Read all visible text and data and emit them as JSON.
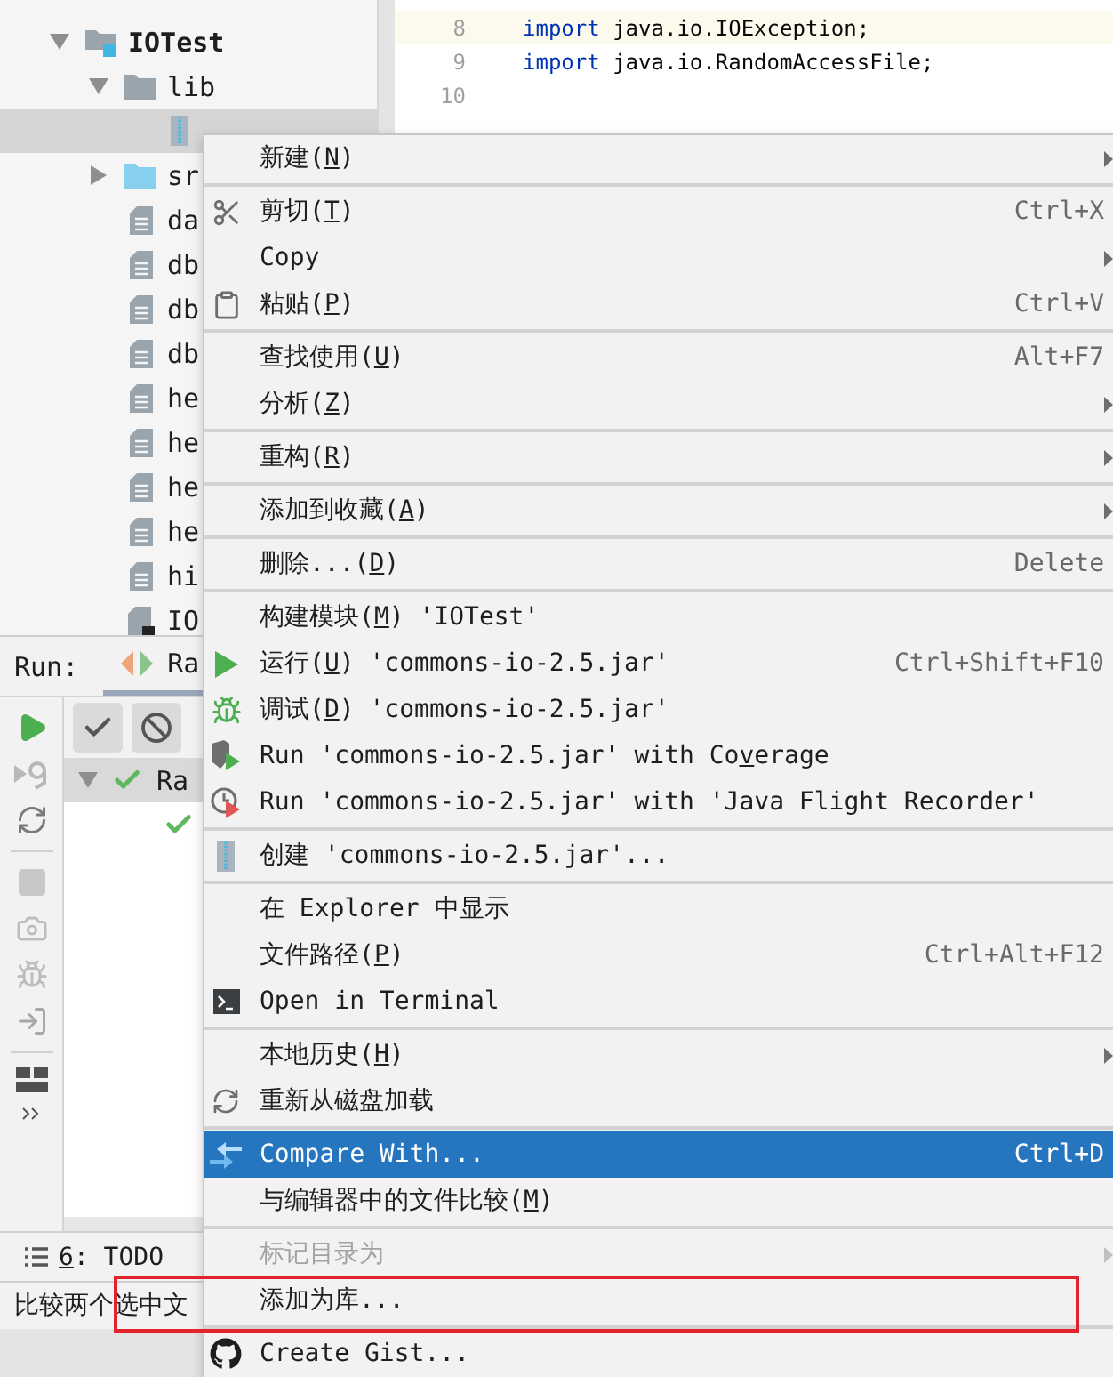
{
  "project_tree": [
    {
      "name": "IOTest",
      "kind": "module",
      "expanded": true,
      "selected": false,
      "children": [
        {
          "name": "lib",
          "kind": "folder",
          "expanded": true,
          "selected": false,
          "children": [
            {
              "kind": "jar",
              "selected": true
            }
          ]
        },
        {
          "name": "sr",
          "kind": "source",
          "expanded": false,
          "selected": false
        },
        {
          "name": "da",
          "kind": "file",
          "selected": false
        },
        {
          "name": "db",
          "kind": "file",
          "selected": false
        },
        {
          "name": "db",
          "kind": "file",
          "selected": false
        },
        {
          "name": "db",
          "kind": "file",
          "selected": false
        },
        {
          "name": "he",
          "kind": "file",
          "selected": false
        },
        {
          "name": "he",
          "kind": "file",
          "selected": false
        },
        {
          "name": "he",
          "kind": "file",
          "selected": false
        },
        {
          "name": "he",
          "kind": "file",
          "selected": false
        },
        {
          "name": "hi",
          "kind": "file",
          "selected": false
        },
        {
          "name": "IO",
          "kind": "config",
          "selected": false
        }
      ]
    }
  ],
  "editor": {
    "lines": [
      {
        "number": "8",
        "current": true,
        "tokens": [
          {
            "kind": "keyword",
            "text": "import"
          },
          {
            "kind": "plain",
            "text": " java.io.IOException;"
          }
        ]
      },
      {
        "number": "9",
        "current": false,
        "tokens": [
          {
            "kind": "keyword",
            "text": "import"
          },
          {
            "kind": "plain",
            "text": " java.io.RandomAccessFile;"
          }
        ]
      },
      {
        "number": "10",
        "current": false
      }
    ]
  },
  "run_panel": {
    "title": "Run:",
    "tabs": [
      {
        "label": "Ra",
        "selected": true
      }
    ],
    "results": [
      {
        "label": "Ra",
        "kind": "passed",
        "expanded": true,
        "selected": true
      },
      {
        "kind": "passed",
        "selected": false
      }
    ]
  },
  "todo_tab": {
    "label": [
      "6",
      ": TODO"
    ]
  },
  "status_bar": {
    "text": "比较两个选中文"
  },
  "context_menu": [
    {
      "kind": "item",
      "label": [
        "新建(",
        "N",
        ")"
      ],
      "submenu": true,
      "selected": false,
      "disabled": false
    },
    {
      "kind": "separator"
    },
    {
      "kind": "item",
      "label": [
        "剪切(",
        "T",
        ")"
      ],
      "shortcut": "Ctrl+X",
      "submenu": false,
      "selected": false,
      "disabled": false
    },
    {
      "kind": "item",
      "label": [
        "Copy"
      ],
      "submenu": true,
      "selected": false,
      "disabled": false
    },
    {
      "kind": "item",
      "label": [
        "粘贴(",
        "P",
        ")"
      ],
      "shortcut": "Ctrl+V",
      "submenu": false,
      "selected": false,
      "disabled": false
    },
    {
      "kind": "separator"
    },
    {
      "kind": "item",
      "label": [
        "查找使用(",
        "U",
        ")"
      ],
      "shortcut": "Alt+F7",
      "submenu": false,
      "selected": false,
      "disabled": false
    },
    {
      "kind": "item",
      "label": [
        "分析(",
        "Z",
        ")"
      ],
      "submenu": true,
      "selected": false,
      "disabled": false
    },
    {
      "kind": "separator"
    },
    {
      "kind": "item",
      "label": [
        "重构(",
        "R",
        ")"
      ],
      "submenu": true,
      "selected": false,
      "disabled": false
    },
    {
      "kind": "separator"
    },
    {
      "kind": "item",
      "label": [
        "添加到收藏(",
        "A",
        ")"
      ],
      "submenu": true,
      "selected": false,
      "disabled": false
    },
    {
      "kind": "separator"
    },
    {
      "kind": "item",
      "label": [
        "删除...(",
        "D",
        ")"
      ],
      "shortcut": "Delete",
      "submenu": false,
      "selected": false,
      "disabled": false
    },
    {
      "kind": "separator"
    },
    {
      "kind": "item",
      "label": [
        "构建模块(",
        "M",
        ") 'IOTest'"
      ],
      "submenu": false,
      "selected": false,
      "disabled": false
    },
    {
      "kind": "item",
      "label": [
        "运行(",
        "U",
        ") 'commons-io-2.5.jar'"
      ],
      "shortcut": "Ctrl+Shift+F10",
      "submenu": false,
      "selected": false,
      "disabled": false
    },
    {
      "kind": "item",
      "label": [
        "调试(",
        "D",
        ") 'commons-io-2.5.jar'"
      ],
      "submenu": false,
      "selected": false,
      "disabled": false
    },
    {
      "kind": "item",
      "label": [
        "Run 'commons-io-2.5.jar' with Co",
        "v",
        "erage"
      ],
      "submenu": false,
      "selected": false,
      "disabled": false
    },
    {
      "kind": "item",
      "label": [
        "Run 'commons-io-2.5.jar' with 'Java Flight Recorder'"
      ],
      "submenu": false,
      "selected": false,
      "disabled": false
    },
    {
      "kind": "separator"
    },
    {
      "kind": "item",
      "label": [
        "创建 'commons-io-2.5.jar'..."
      ],
      "submenu": false,
      "selected": false,
      "disabled": false
    },
    {
      "kind": "separator"
    },
    {
      "kind": "item",
      "label": [
        "在 Explorer 中显示"
      ],
      "submenu": false,
      "selected": false,
      "disabled": false
    },
    {
      "kind": "item",
      "label": [
        "文件路径(",
        "P",
        ")"
      ],
      "shortcut": "Ctrl+Alt+F12",
      "submenu": false,
      "selected": false,
      "disabled": false
    },
    {
      "kind": "item",
      "label": [
        "Open in Terminal"
      ],
      "submenu": false,
      "selected": false,
      "disabled": false
    },
    {
      "kind": "separator"
    },
    {
      "kind": "item",
      "label": [
        "本地历史(",
        "H",
        ")"
      ],
      "submenu": true,
      "selected": false,
      "disabled": false
    },
    {
      "kind": "item",
      "label": [
        "重新从磁盘加载"
      ],
      "submenu": false,
      "selected": false,
      "disabled": false
    },
    {
      "kind": "separator"
    },
    {
      "kind": "item",
      "label": [
        "Compare With..."
      ],
      "shortcut": "Ctrl+D",
      "submenu": false,
      "selected": true,
      "disabled": false
    },
    {
      "kind": "item",
      "label": [
        "与编辑器中的文件比较(",
        "M",
        ")"
      ],
      "submenu": false,
      "selected": false,
      "disabled": false
    },
    {
      "kind": "separator"
    },
    {
      "kind": "item",
      "label": [
        "标记目录为"
      ],
      "submenu": true,
      "selected": false,
      "disabled": true
    },
    {
      "kind": "item",
      "label": [
        "添加为库..."
      ],
      "submenu": false,
      "selected": false,
      "disabled": false
    },
    {
      "kind": "separator"
    },
    {
      "kind": "item",
      "label": [
        "Create Gist..."
      ],
      "submenu": false,
      "selected": false,
      "disabled": false
    }
  ],
  "annotation_frame": {
    "visible": true
  }
}
